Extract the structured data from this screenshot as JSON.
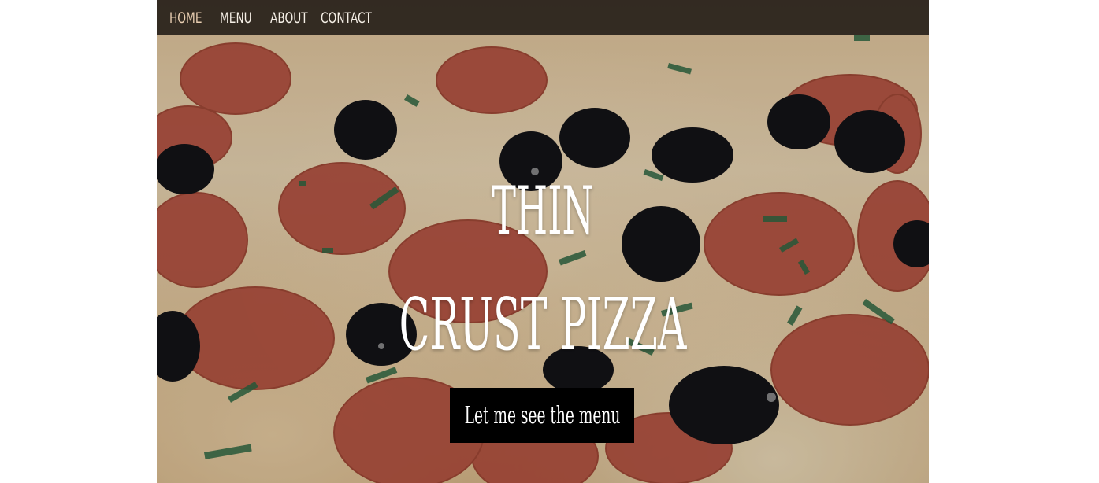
{
  "nav": {
    "items": [
      {
        "label": "HOME"
      },
      {
        "label": "MENU"
      },
      {
        "label": "ABOUT"
      },
      {
        "label": "CONTACT"
      }
    ]
  },
  "hero": {
    "title_line_1": "THIN",
    "title_line_2": "CRUST PIZZA",
    "cta_label": "Let me see the menu",
    "background": "pepperoni-olive-pizza-photo"
  },
  "colors": {
    "nav_bg": "#14100c",
    "nav_text": "#f5efe6",
    "cta_bg": "#000000",
    "cta_text": "#ffffff"
  }
}
